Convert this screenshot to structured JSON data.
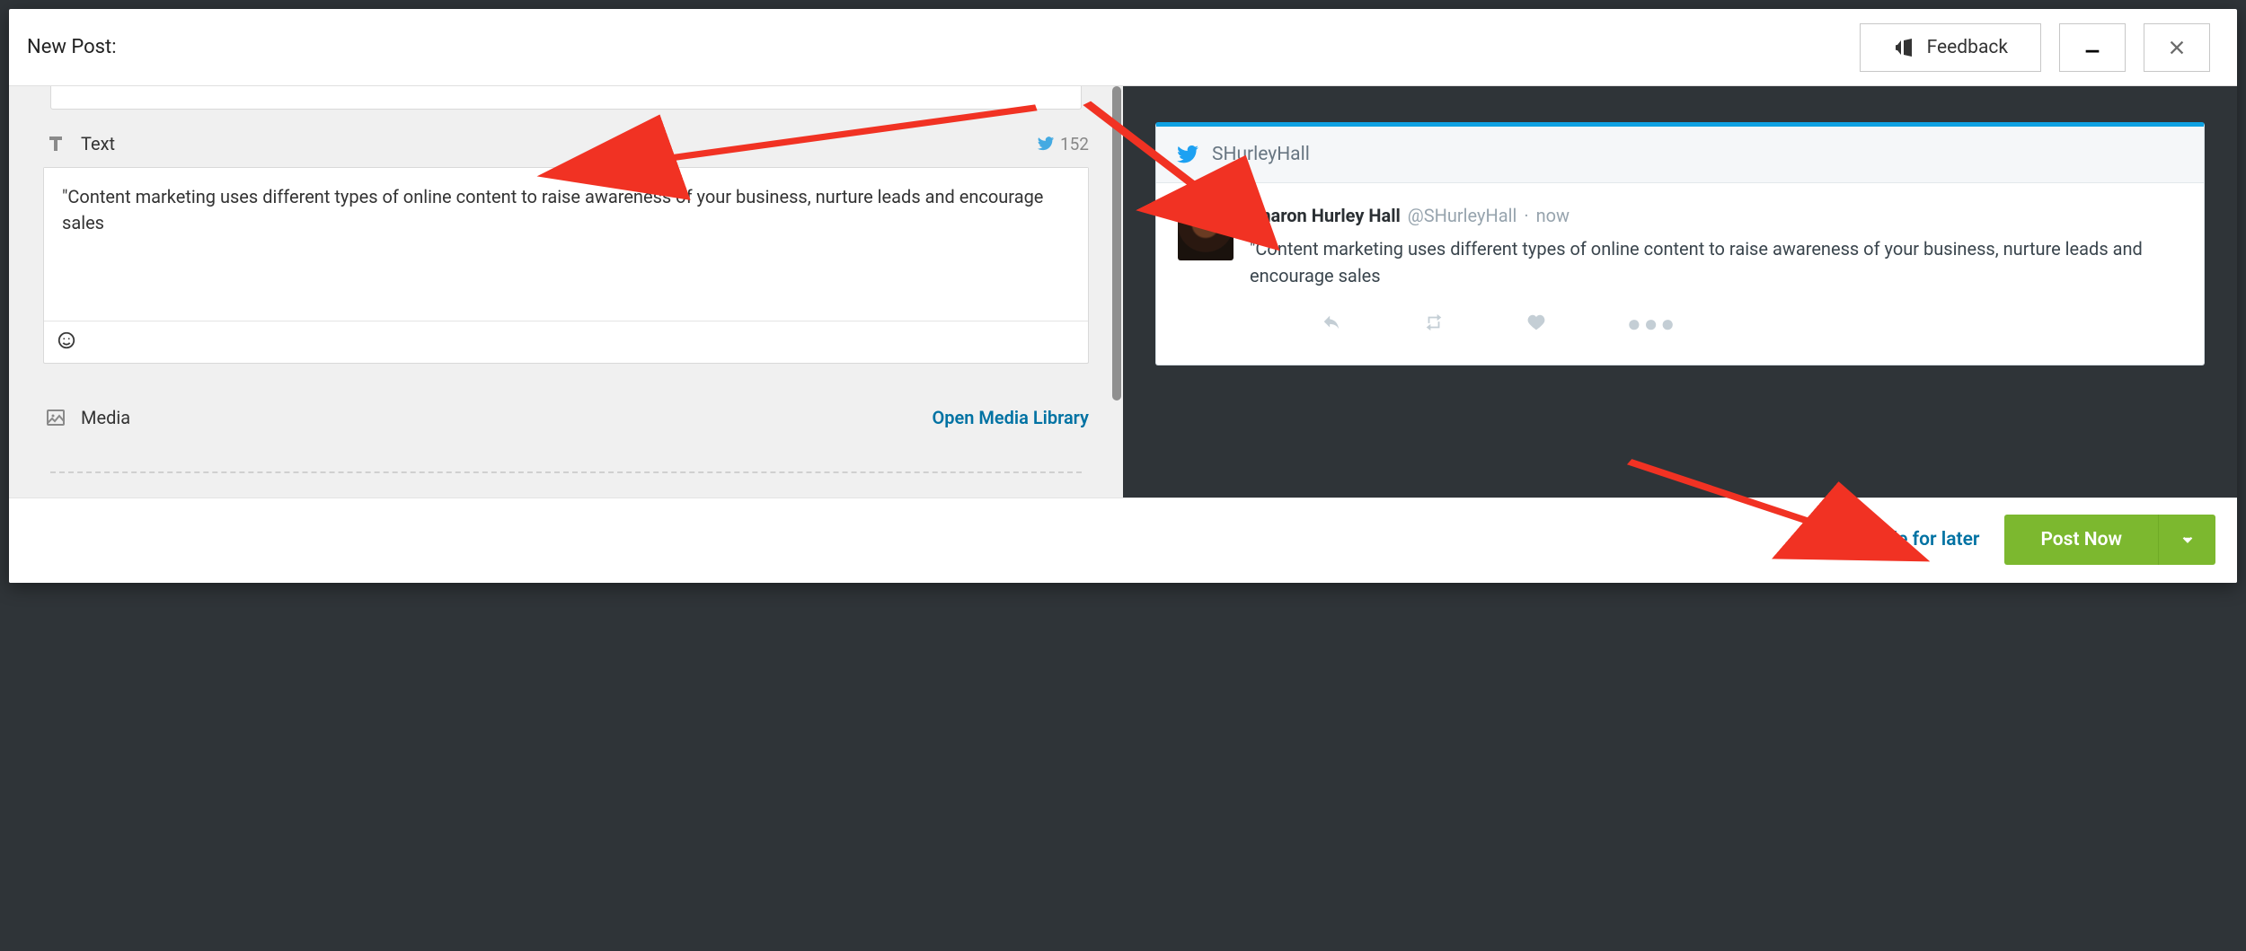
{
  "header": {
    "title": "New Post:",
    "feedback_label": "Feedback"
  },
  "compose": {
    "text_section_label": "Text",
    "char_count": "152",
    "text_value": "\"Content marketing uses different types of online content to raise awareness of your business, nurture leads and encourage sales",
    "media_section_label": "Media",
    "media_library_link": "Open Media Library"
  },
  "preview": {
    "account_handle": "SHurleyHall",
    "display_name": "Sharon Hurley Hall",
    "at_handle": "@SHurleyHall",
    "time": "now",
    "tweet_text": "\"Content marketing uses different types of online content to raise awareness of your business, nurture leads and encourage sales"
  },
  "footer": {
    "schedule_label": "Schedule for later",
    "post_label": "Post Now"
  },
  "colors": {
    "accent_blue": "#0072a3",
    "twitter_blue": "#1da1f2",
    "post_green": "#7cb82f",
    "arrow_red": "#f13223"
  }
}
